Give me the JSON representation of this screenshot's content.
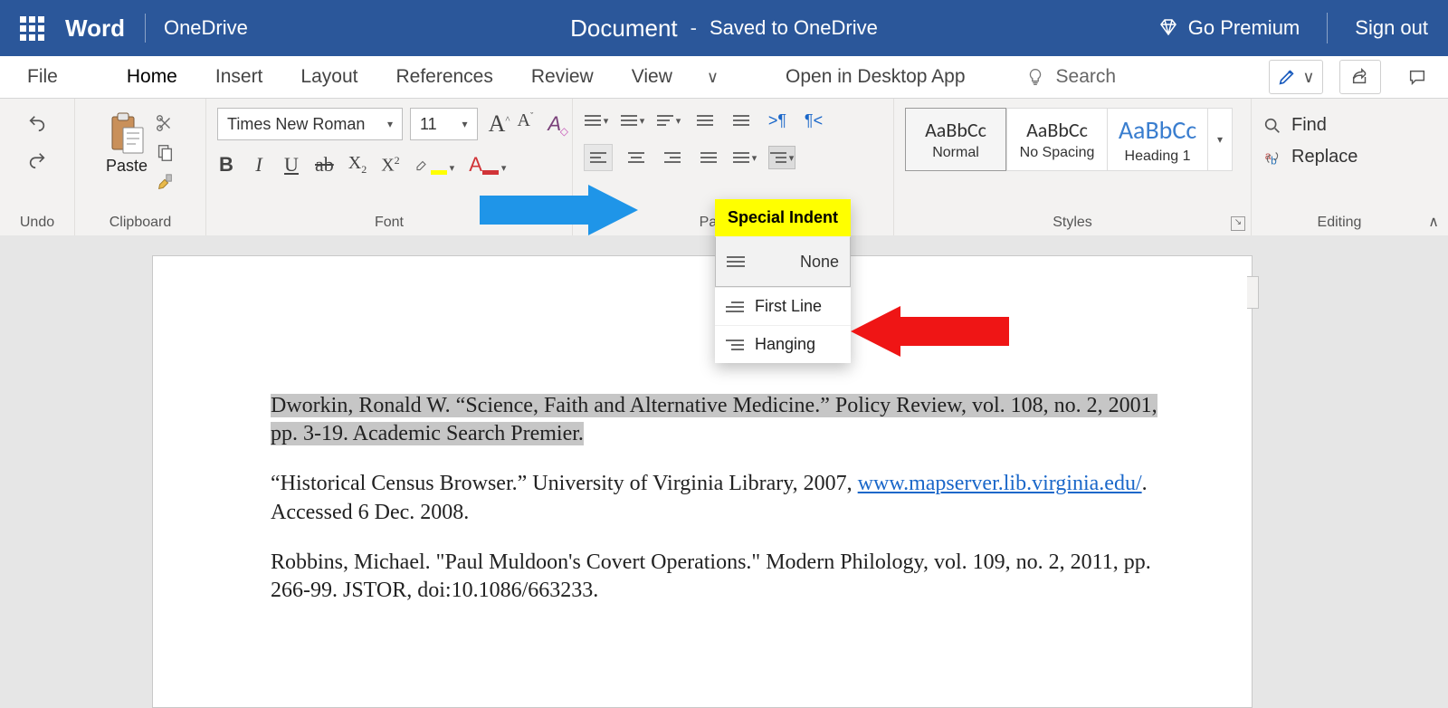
{
  "titlebar": {
    "app": "Word",
    "location": "OneDrive",
    "docname": "Document",
    "saved": "Saved to OneDrive",
    "premium": "Go Premium",
    "signout": "Sign out"
  },
  "tabs": {
    "file": "File",
    "home": "Home",
    "insert": "Insert",
    "layout": "Layout",
    "references": "References",
    "review": "Review",
    "view": "View",
    "desktop": "Open in Desktop App",
    "search_placeholder": "Search"
  },
  "ribbon": {
    "undo_label": "Undo",
    "clipboard_label": "Clipboard",
    "paste": "Paste",
    "font_label": "Font",
    "font_name": "Times New Roman",
    "font_size": "11",
    "paragraph_label": "Paragraph",
    "styles_label": "Styles",
    "editing_label": "Editing",
    "find": "Find",
    "replace": "Replace",
    "styles": {
      "normal_sample": "AaBbCc",
      "normal": "Normal",
      "nospacing_sample": "AaBbCc",
      "nospacing": "No Spacing",
      "heading1_sample": "AaBbCc",
      "heading1": "Heading 1"
    }
  },
  "popup": {
    "title": "Special Indent",
    "none": "None",
    "firstline": "First Line",
    "hanging": "Hanging"
  },
  "doc": {
    "sel_line1": "Dworkin, Ronald W. “Science, Faith and Alternative Medicine.” Policy Review, vol. 108, no. 2, 2001,",
    "sel_line2": "pp. 3-19. Academic Search Premier.",
    "cite2_a": "“Historical Census Browser.” University of Virginia Library, 2007, ",
    "cite2_link": "www.mapserver.lib.virginia.edu/",
    "cite2_b": ". Accessed 6 Dec. 2008.",
    "cite3": "Robbins, Michael. \"Paul Muldoon's Covert Operations.\" Modern Philology, vol. 109, no. 2, 2011, pp. 266-99. JSTOR, doi:10.1086/663233."
  }
}
